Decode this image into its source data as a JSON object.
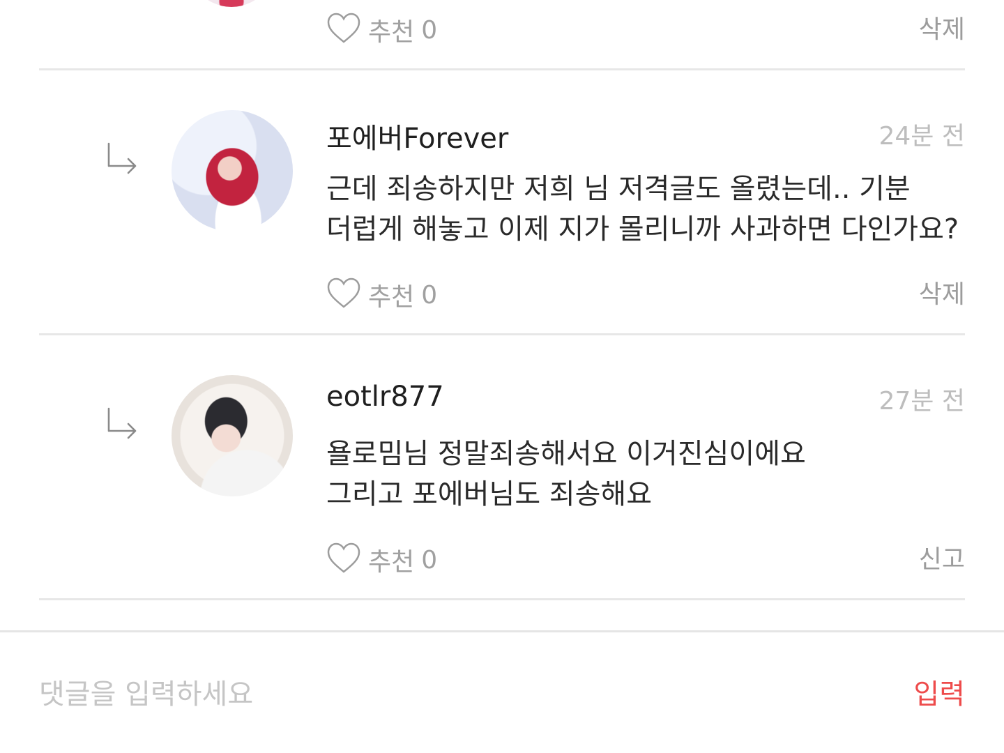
{
  "top_partial": {
    "like_label": "추천",
    "like_count": "0",
    "action_label": "삭제"
  },
  "replies": [
    {
      "username": "포에버Forever",
      "timestamp": "24분 전",
      "comment_line1": "근데 죄송하지만 저희 님 저격글도 올렸는데.. 기분",
      "comment_line2": "더럽게 해놓고 이제 지가 몰리니까 사과하면 다인가요?",
      "like_label": "추천",
      "like_count": "0",
      "action_label": "삭제"
    },
    {
      "username": "eotlr877",
      "timestamp": "27분 전",
      "comment_line1": "욜로밈님 정말죄송해서요 이거진심이에요",
      "comment_line2": "그리고 포에버님도 죄송해요",
      "like_label": "추천",
      "like_count": "0",
      "action_label": "신고"
    }
  ],
  "input_bar": {
    "placeholder": "댓글을 입력하세요",
    "submit_label": "입력"
  },
  "colors": {
    "accent": "#ee4b4b",
    "muted_text": "#a0a0a0",
    "divider": "#e7e7e7"
  }
}
